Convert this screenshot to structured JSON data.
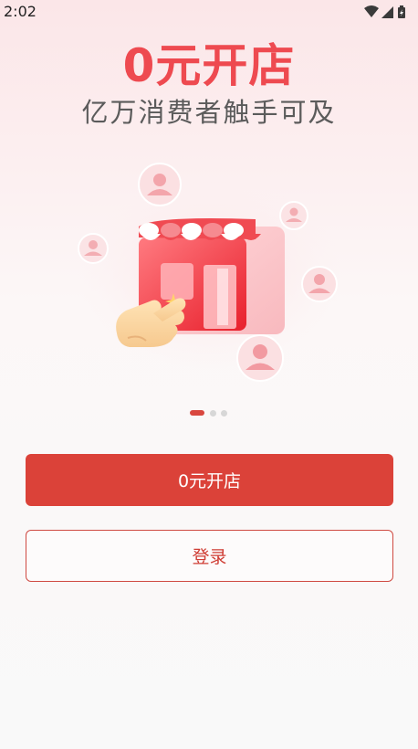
{
  "status_bar": {
    "time": "2:02",
    "icons": [
      "wifi-icon",
      "signal-icon",
      "battery-icon"
    ]
  },
  "hero": {
    "title": "0元开店",
    "subtitle": "亿万消费者触手可及"
  },
  "carousel": {
    "page_count": 3,
    "active_index": 0
  },
  "actions": {
    "primary_label": "0元开店",
    "secondary_label": "登录"
  },
  "colors": {
    "accent": "#db4239",
    "title": "#ee4a50",
    "subtitle": "#5b5b5b"
  }
}
